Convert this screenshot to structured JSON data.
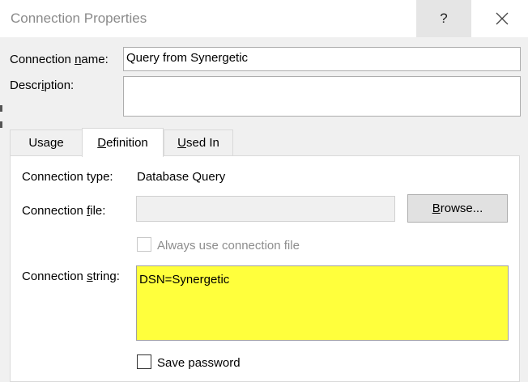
{
  "window": {
    "title": "Connection Properties",
    "help_label": "?"
  },
  "fields": {
    "connection_name_label_pre": "Connection ",
    "connection_name_label_ul": "n",
    "connection_name_label_post": "ame:",
    "connection_name_value": "Query from Synergetic",
    "description_label_pre": "Descr",
    "description_label_ul": "i",
    "description_label_post": "ption:"
  },
  "tabs": [
    {
      "label": "Usage"
    },
    {
      "label_ul": "D",
      "label_rest": "efinition"
    },
    {
      "label_ul": "U",
      "label_rest": "sed In"
    }
  ],
  "definition": {
    "connection_type_label": "Connection type:",
    "connection_type_value": "Database Query",
    "connection_file_label_pre": "Connection ",
    "connection_file_label_ul": "f",
    "connection_file_label_post": "ile:",
    "browse_ul": "B",
    "browse_rest": "rowse...",
    "always_use_label": "Always use connection file",
    "connection_string_label_pre": "Connection ",
    "connection_string_label_ul": "s",
    "connection_string_label_post": "tring:",
    "connection_string_value": "DSN=Synergetic",
    "save_password_label": "Save password"
  },
  "colors": {
    "highlight": "#ffff3c",
    "title_text": "#8a8a8a",
    "disabled_text": "#8d8d8d"
  }
}
